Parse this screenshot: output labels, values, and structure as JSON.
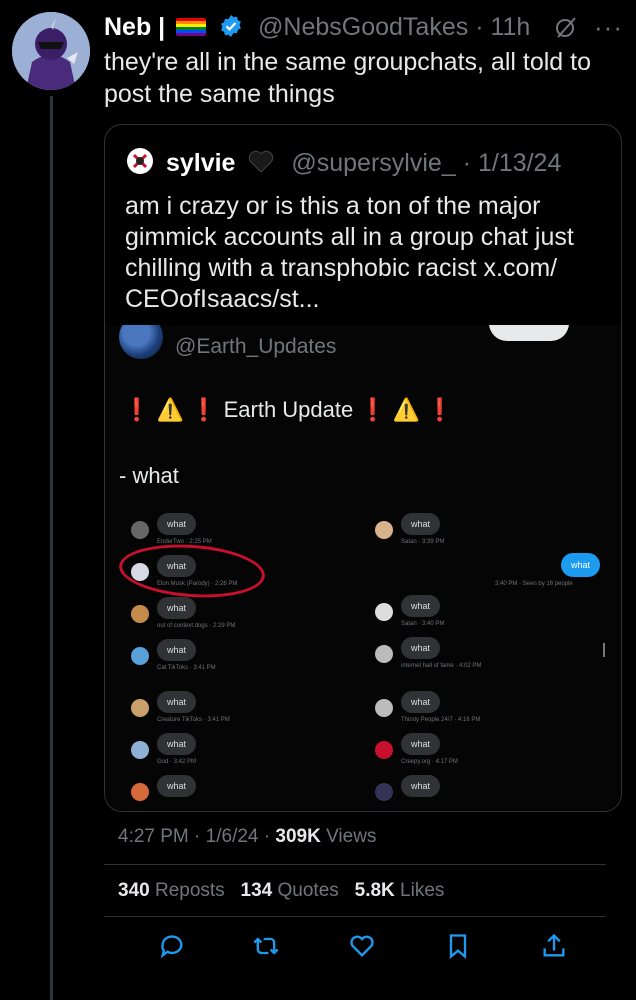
{
  "post": {
    "author_name": "Neb |",
    "handle": "@NebsGoodTakes",
    "sep": "·",
    "time": "11h",
    "text": "they're all in the same groupchats, all told to post the same things"
  },
  "quote": {
    "author_name": "sylvie",
    "handle": "@supersylvie_",
    "sep": "·",
    "date": "1/13/24",
    "text": "am i crazy or is this a ton of the major gimmick accounts all in a group chat just chilling with a transphobic racist x.com/ CEOofIsaacs/st...",
    "embed": {
      "handle": "@Earth_Updates",
      "headline": "Earth Update",
      "body": "- what",
      "left_chats": [
        {
          "bubble": "what",
          "meta": "EnderTwo · 2:25 PM"
        },
        {
          "bubble": "what",
          "meta": "Elon Musk (Parody) · 2:26 PM"
        },
        {
          "bubble": "what",
          "meta": "out of context dogs · 2:29 PM"
        },
        {
          "bubble": "what",
          "meta": "Cat TikToks · 3:41 PM"
        },
        {
          "bubble": "what",
          "meta": "Creature TikToks · 3:41 PM"
        },
        {
          "bubble": "what",
          "meta": "God · 3:42 PM"
        },
        {
          "bubble": "what",
          "meta": ""
        }
      ],
      "right_chats": [
        {
          "bubble": "what",
          "meta": "Satan · 3:39 PM"
        },
        {
          "bubble": "what",
          "meta": "Satan · 3:40 PM"
        },
        {
          "bubble": "what",
          "meta": "internet hall of fame · 4:02 PM"
        },
        {
          "bubble": "what",
          "meta": "Thirsty People 24/7 · 4:16 PM"
        },
        {
          "bubble": "what",
          "meta": "Creepy.org · 4:17 PM"
        },
        {
          "bubble": "what",
          "meta": ""
        }
      ],
      "own_bubble": "what",
      "own_meta": "3:40 PM · Seen by 16 people"
    }
  },
  "footer": {
    "time": "4:27 PM",
    "date": "1/6/24",
    "views_count": "309K",
    "views_label": "Views",
    "reposts_count": "340",
    "reposts_label": "Reposts",
    "quotes_count": "134",
    "quotes_label": "Quotes",
    "likes_count": "5.8K",
    "likes_label": "Likes"
  },
  "icons": [
    "reply-icon",
    "repost-icon",
    "like-icon",
    "bookmark-icon",
    "share-icon",
    "grok-icon",
    "more-icon",
    "verified-icon"
  ],
  "colors": {
    "background": "#000000",
    "text": "#e7e9ea",
    "muted": "#71767b",
    "accent": "#1d9bf0",
    "border": "#2f3336"
  }
}
